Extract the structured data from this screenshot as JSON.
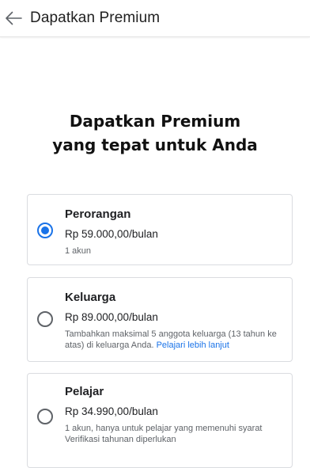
{
  "appbar": {
    "title": "Dapatkan Premium",
    "back_icon": "arrow-left-icon"
  },
  "headline": {
    "line1": "Dapatkan Premium",
    "line2": "yang tepat untuk Anda"
  },
  "plans": [
    {
      "name": "Perorangan",
      "price": "Rp 59.000,00/bulan",
      "desc": "1 akun",
      "selected": true
    },
    {
      "name": "Keluarga",
      "price": "Rp 89.000,00/bulan",
      "desc": "Tambahkan maksimal 5 anggota keluarga (13 tahun ke atas) di keluarga Anda.",
      "link": "Pelajari lebih lanjut",
      "selected": false
    },
    {
      "name": "Pelajar",
      "price": "Rp 34.990,00/bulan",
      "desc1": "1 akun, hanya untuk pelajar yang memenuhi syarat",
      "desc2": "Verifikasi tahunan diperlukan",
      "selected": false
    }
  ],
  "colors": {
    "accent": "#1a73e8",
    "border": "#dadce0",
    "secondary_text": "#5f6368"
  }
}
